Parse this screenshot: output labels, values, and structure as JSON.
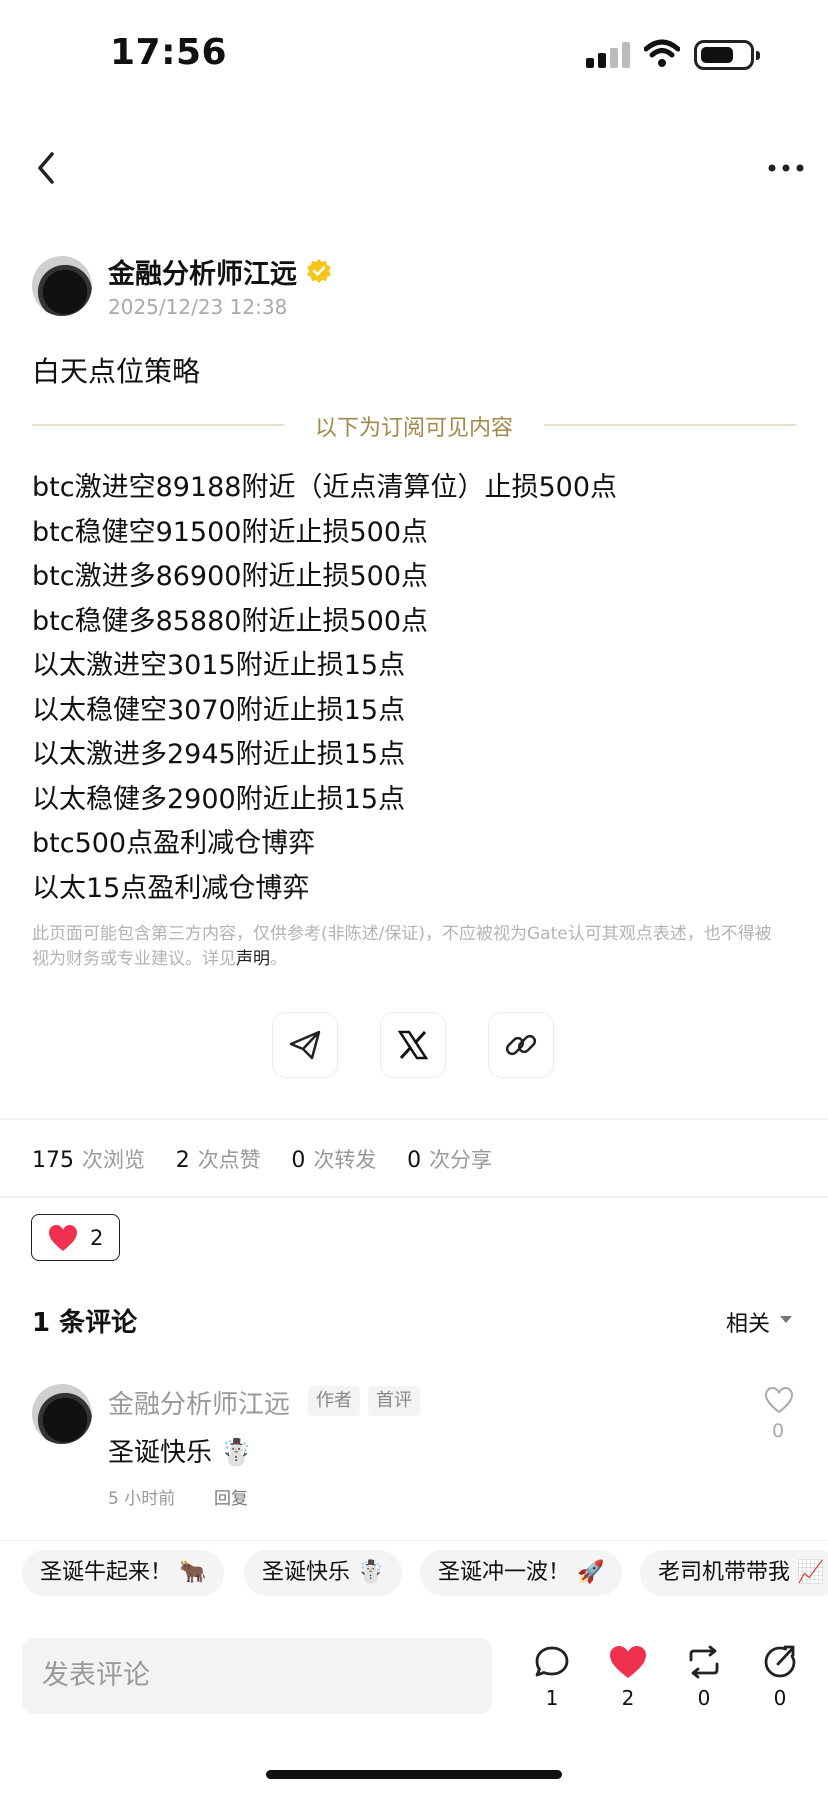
{
  "status_bar": {
    "time": "17:56"
  },
  "post": {
    "author": "金融分析师江远",
    "date": "2025/12/23 12:38",
    "title": "白天点位策略",
    "subscriber_divider": "以下为订阅可见内容",
    "lines": [
      "btc激进空89188附近（近点清算位）止损500点",
      "btc稳健空91500附近止损500点",
      "btc激进多86900附近止损500点",
      "btc稳健多85880附近止损500点",
      "以太激进空3015附近止损15点",
      "以太稳健空3070附近止损15点",
      "以太激进多2945附近止损15点",
      "以太稳健多2900附近止损15点",
      "btc500点盈利减仓博弈",
      "以太15点盈利减仓博弈"
    ],
    "disclaimer_text": "此页面可能包含第三方内容，仅供参考(非陈述/保证)，不应被视为Gate认可其观点表述，也不得被视为财务或专业建议。详见",
    "disclaimer_link": "声明",
    "disclaimer_end": "。"
  },
  "share_icons": [
    "telegram-icon",
    "x-icon",
    "link-icon"
  ],
  "stats": [
    {
      "value": "175",
      "label": "次浏览"
    },
    {
      "value": "2",
      "label": "次点赞"
    },
    {
      "value": "0",
      "label": "次转发"
    },
    {
      "value": "0",
      "label": "次分享"
    }
  ],
  "reaction": {
    "count": "2"
  },
  "comments": {
    "title": "1 条评论",
    "sort_label": "相关",
    "items": [
      {
        "author": "金融分析师江远",
        "tags": [
          "作者",
          "首评"
        ],
        "text": "圣诞快乐 ☃️",
        "time": "5 小时前",
        "reply": "回复",
        "likes": "0"
      }
    ]
  },
  "quick_chips": [
    "圣诞牛起来！ 🐂",
    "圣诞快乐 ☃️",
    "圣诞冲一波！ 🚀",
    "老司机带带我 📈"
  ],
  "bottom_bar": {
    "input_placeholder": "发表评论",
    "actions": [
      {
        "icon": "comment-icon",
        "count": "1"
      },
      {
        "icon": "heart-icon",
        "count": "2"
      },
      {
        "icon": "repost-icon",
        "count": "0"
      },
      {
        "icon": "share-icon",
        "count": "0"
      }
    ]
  },
  "colors": {
    "gold": "#a3894a",
    "heart": "#f0304f",
    "verified": "#f5c518"
  }
}
